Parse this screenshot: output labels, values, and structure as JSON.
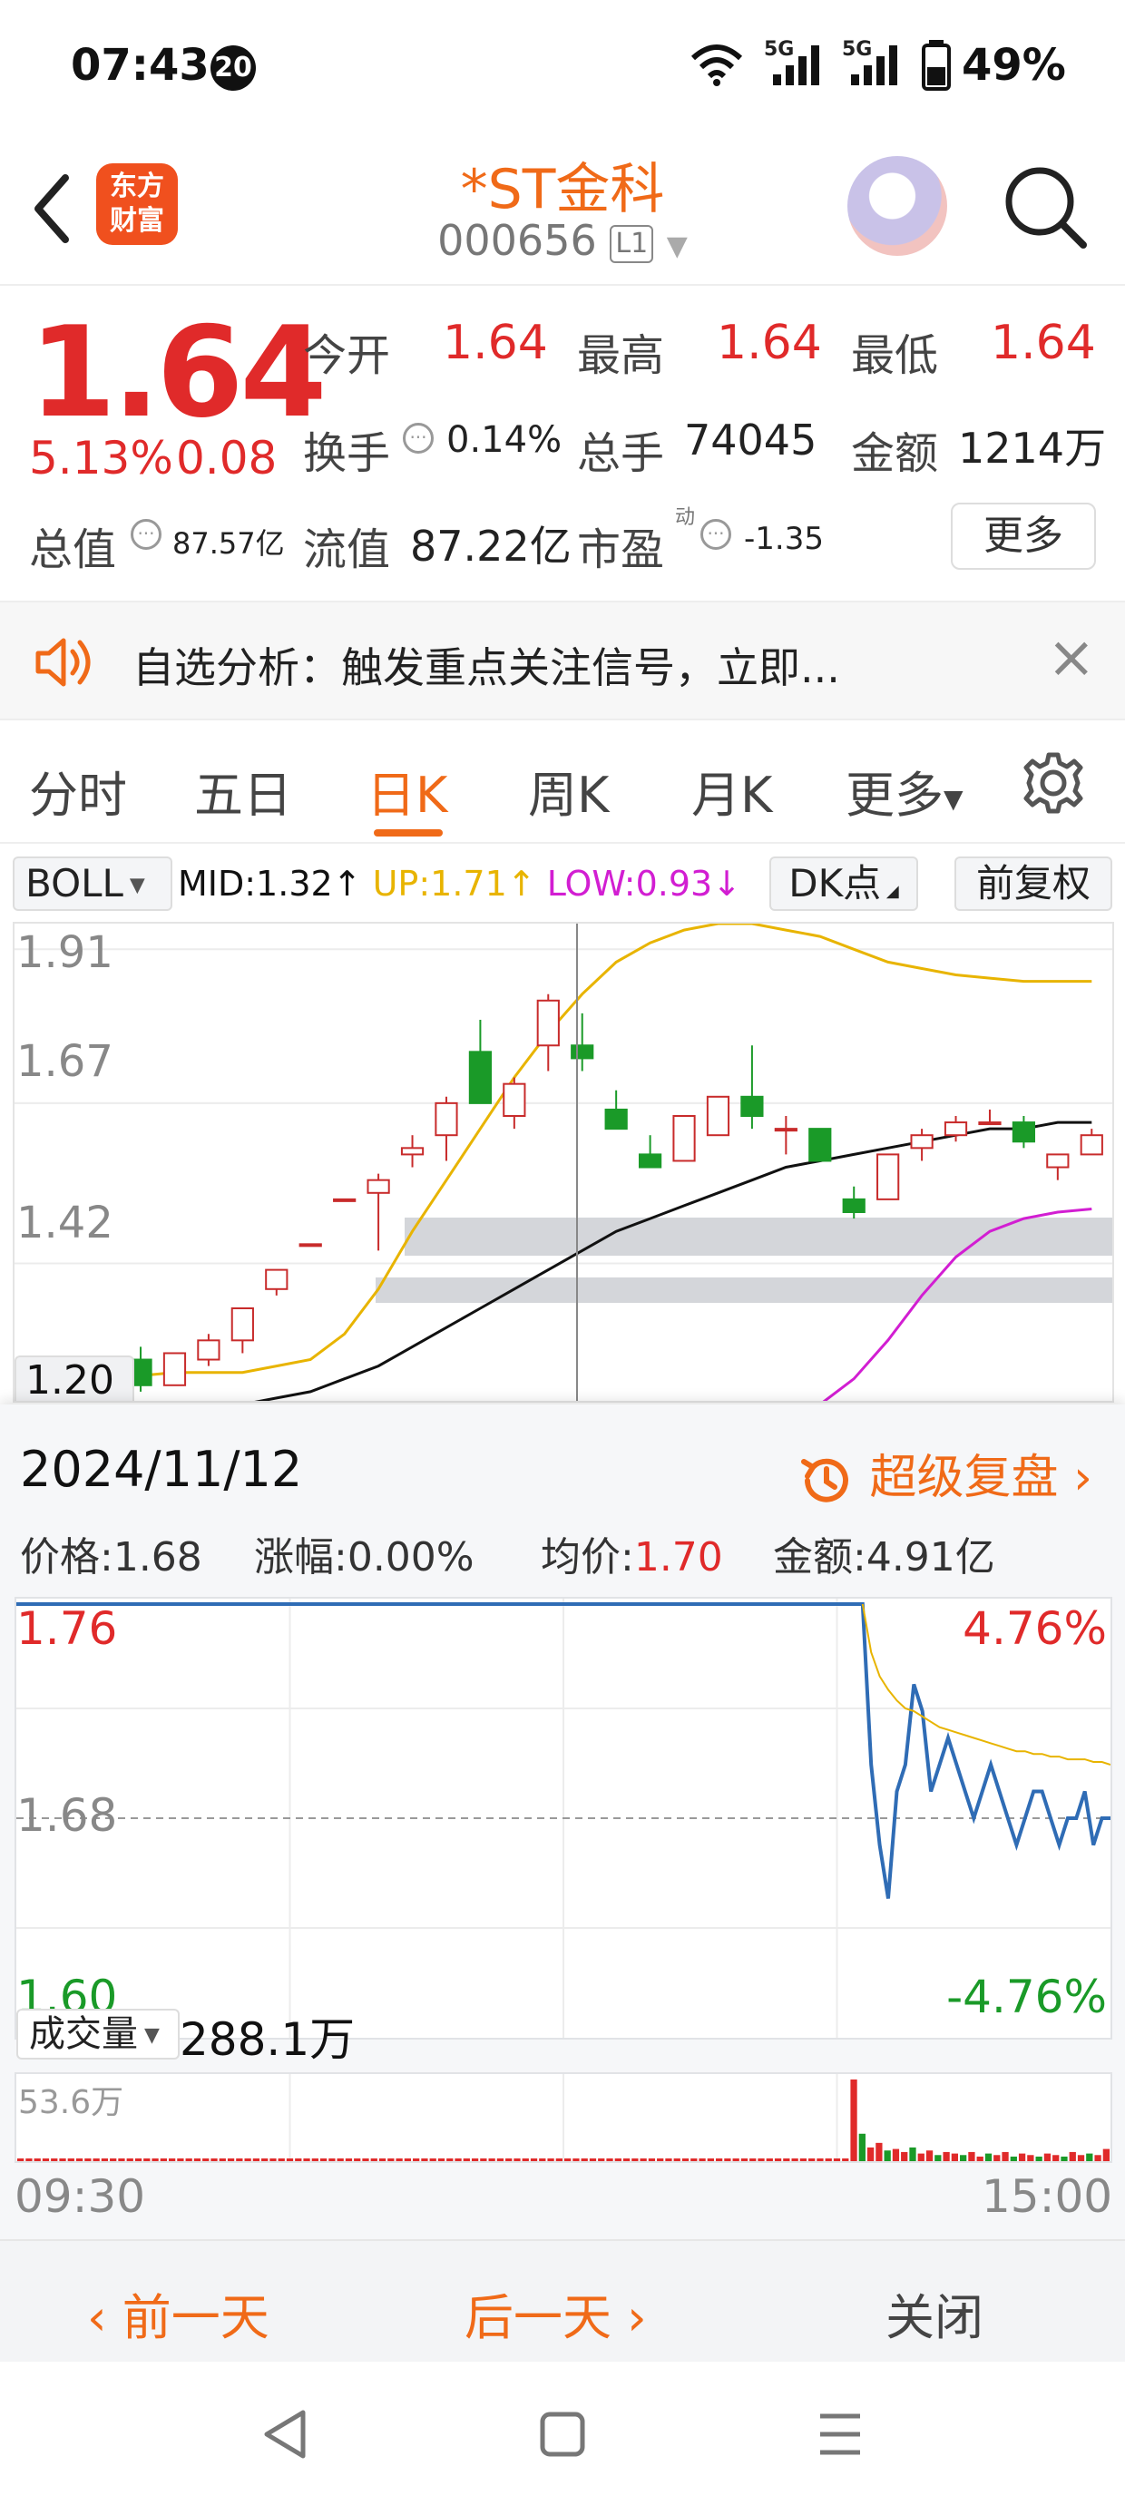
{
  "status_bar": {
    "time": "07:43",
    "notification_count": "20",
    "network_1": "5G",
    "network_2": "5G",
    "battery": "49%"
  },
  "header": {
    "logo_line1": "东方",
    "logo_line2": "财富",
    "stock_name": "*ST金科",
    "stock_code": "000656",
    "level_badge": "L1"
  },
  "quote": {
    "price": "1.64",
    "change_pct": "5.13%",
    "change_amt": "0.08",
    "open_label": "今开",
    "open_value": "1.64",
    "high_label": "最高",
    "high_value": "1.64",
    "low_label": "最低",
    "low_value": "1.64",
    "turnover_label": "换手",
    "turnover_value": "0.14%",
    "volume_label": "总手",
    "volume_value": "74045",
    "amount_label": "金额",
    "amount_value": "1214万",
    "total_cap_label": "总值",
    "total_cap_value": "87.57亿",
    "float_cap_label": "流值",
    "float_cap_value": "87.22亿",
    "pe_label": "市盈",
    "pe_superscript": "动",
    "pe_value": "-1.35",
    "more_button": "更多"
  },
  "notice": {
    "text": "自选分析：触发重点关注信号，立即...",
    "close": "×"
  },
  "tabs": [
    "分时",
    "五日",
    "日K",
    "周K",
    "月K",
    "更多"
  ],
  "active_tab": "日K",
  "indicator": {
    "name": "BOLL",
    "mid": "MID:1.32↑",
    "up": "UP:1.71↑",
    "low": "LOW:0.93↓",
    "dk_button": "DK点",
    "adjust_button": "前复权",
    "colors": {
      "mid": "#111111",
      "up": "#e8b400",
      "low": "#d21ed2"
    }
  },
  "kline": {
    "y_labels": [
      "1.91",
      "1.67",
      "1.42",
      "1.20"
    ]
  },
  "popup": {
    "date": "2024/11/12",
    "review_button": "超级复盘",
    "price_label": "价格:",
    "price_value": "1.68",
    "change_label": "涨幅:",
    "change_value": "0.00%",
    "avg_label": "均价:",
    "avg_value": "1.70",
    "amount_label": "金额:",
    "amount_value": "4.91亿",
    "y_top": "1.76",
    "y_mid": "1.68",
    "y_bottom": "1.60",
    "pct_top": "4.76%",
    "pct_bottom": "-4.76%",
    "volume_selector": "成交量",
    "volume_total": "288.1万",
    "volume_max": "53.6万",
    "time_start": "09:30",
    "time_end": "15:00",
    "prev_day": "前一天",
    "next_day": "后一天",
    "close": "关闭"
  },
  "chart_data": [
    {
      "type": "candlestick",
      "title": "",
      "y_tick_labels": [
        "1.91",
        "1.67",
        "1.42",
        "1.20"
      ],
      "ylim": [
        1.2,
        1.95
      ],
      "candles": [
        {
          "o": 1.19,
          "h": 1.2,
          "l": 1.18,
          "c": 1.19
        },
        {
          "o": 1.2,
          "h": 1.21,
          "l": 1.2,
          "c": 1.21
        },
        {
          "o": 1.2,
          "h": 1.25,
          "l": 1.2,
          "c": 1.25
        },
        {
          "o": 1.27,
          "h": 1.29,
          "l": 1.22,
          "c": 1.23
        },
        {
          "o": 1.23,
          "h": 1.28,
          "l": 1.23,
          "c": 1.28
        },
        {
          "o": 1.27,
          "h": 1.31,
          "l": 1.26,
          "c": 1.3
        },
        {
          "o": 1.3,
          "h": 1.35,
          "l": 1.28,
          "c": 1.35
        },
        {
          "o": 1.38,
          "h": 1.41,
          "l": 1.37,
          "c": 1.41
        },
        {
          "o": 1.45,
          "h": 1.45,
          "l": 1.45,
          "c": 1.45
        },
        {
          "o": 1.52,
          "h": 1.52,
          "l": 1.52,
          "c": 1.52
        },
        {
          "o": 1.53,
          "h": 1.56,
          "l": 1.44,
          "c": 1.55
        },
        {
          "o": 1.59,
          "h": 1.62,
          "l": 1.57,
          "c": 1.6
        },
        {
          "o": 1.62,
          "h": 1.68,
          "l": 1.58,
          "c": 1.67
        },
        {
          "o": 1.75,
          "h": 1.8,
          "l": 1.67,
          "c": 1.67
        },
        {
          "o": 1.65,
          "h": 1.71,
          "l": 1.63,
          "c": 1.7
        },
        {
          "o": 1.76,
          "h": 1.84,
          "l": 1.72,
          "c": 1.83
        },
        {
          "o": 1.76,
          "h": 1.81,
          "l": 1.72,
          "c": 1.74
        },
        {
          "o": 1.66,
          "h": 1.69,
          "l": 1.63,
          "c": 1.63
        },
        {
          "o": 1.59,
          "h": 1.62,
          "l": 1.57,
          "c": 1.57
        },
        {
          "o": 1.58,
          "h": 1.65,
          "l": 1.58,
          "c": 1.65
        },
        {
          "o": 1.62,
          "h": 1.68,
          "l": 1.62,
          "c": 1.68
        },
        {
          "o": 1.68,
          "h": 1.76,
          "l": 1.63,
          "c": 1.65
        },
        {
          "o": 1.63,
          "h": 1.65,
          "l": 1.59,
          "c": 1.63
        },
        {
          "o": 1.63,
          "h": 1.63,
          "l": 1.58,
          "c": 1.58
        },
        {
          "o": 1.52,
          "h": 1.54,
          "l": 1.49,
          "c": 1.5
        },
        {
          "o": 1.52,
          "h": 1.59,
          "l": 1.52,
          "c": 1.59
        },
        {
          "o": 1.6,
          "h": 1.63,
          "l": 1.58,
          "c": 1.62
        },
        {
          "o": 1.62,
          "h": 1.65,
          "l": 1.61,
          "c": 1.64
        },
        {
          "o": 1.64,
          "h": 1.66,
          "l": 1.64,
          "c": 1.64
        },
        {
          "o": 1.64,
          "h": 1.65,
          "l": 1.6,
          "c": 1.61
        },
        {
          "o": 1.57,
          "h": 1.59,
          "l": 1.55,
          "c": 1.59
        },
        {
          "o": 1.59,
          "h": 1.63,
          "l": 1.59,
          "c": 1.62
        }
      ],
      "boll_mid": [
        1.19,
        1.19,
        1.19,
        1.19,
        1.2,
        1.2,
        1.2,
        1.21,
        1.22,
        1.24,
        1.26,
        1.29,
        1.32,
        1.35,
        1.38,
        1.41,
        1.44,
        1.47,
        1.49,
        1.51,
        1.53,
        1.55,
        1.57,
        1.58,
        1.59,
        1.6,
        1.61,
        1.62,
        1.63,
        1.63,
        1.64,
        1.64
      ],
      "boll_up": [
        1.24,
        1.24,
        1.245,
        1.245,
        1.25,
        1.25,
        1.25,
        1.26,
        1.27,
        1.31,
        1.38,
        1.47,
        1.55,
        1.63,
        1.71,
        1.78,
        1.84,
        1.89,
        1.92,
        1.94,
        1.95,
        1.95,
        1.94,
        1.93,
        1.91,
        1.89,
        1.88,
        1.87,
        1.865,
        1.86,
        1.86,
        1.86
      ],
      "boll_low": [
        null,
        null,
        null,
        null,
        null,
        null,
        null,
        null,
        null,
        null,
        null,
        null,
        null,
        null,
        null,
        null,
        null,
        null,
        null,
        null,
        null,
        null,
        null,
        1.2,
        1.24,
        1.3,
        1.37,
        1.43,
        1.47,
        1.49,
        1.5,
        1.505
      ]
    },
    {
      "type": "line",
      "title": "",
      "x_tick_labels": [
        "09:30",
        "15:00"
      ],
      "y_tick_labels": [
        "1.76",
        "1.68",
        "1.60"
      ],
      "ylim": [
        1.6,
        1.76
      ],
      "series": [
        {
          "values": [
            1.76,
            1.76,
            1.76,
            1.76,
            1.76,
            1.76,
            1.76,
            1.76,
            1.76,
            1.76,
            1.76,
            1.76,
            1.76,
            1.76,
            1.76,
            1.76,
            1.76,
            1.76,
            1.76,
            1.76,
            1.76,
            1.76,
            1.76,
            1.76,
            1.76,
            1.76,
            1.76,
            1.76,
            1.76,
            1.76,
            1.76,
            1.76,
            1.76,
            1.76,
            1.76,
            1.76,
            1.76,
            1.76,
            1.76,
            1.76,
            1.76,
            1.76,
            1.76,
            1.76,
            1.76,
            1.76,
            1.76,
            1.76,
            1.76,
            1.76,
            1.76,
            1.76,
            1.76,
            1.76,
            1.76,
            1.76,
            1.76,
            1.76,
            1.76,
            1.76,
            1.76,
            1.76,
            1.76,
            1.76,
            1.76,
            1.76,
            1.76,
            1.76,
            1.76,
            1.76,
            1.76,
            1.76,
            1.76,
            1.76,
            1.76,
            1.76,
            1.76,
            1.76,
            1.76,
            1.76,
            1.76,
            1.76,
            1.76,
            1.76,
            1.76,
            1.76,
            1.76,
            1.76,
            1.76,
            1.76,
            1.76,
            1.76,
            1.76,
            1.76,
            1.76,
            1.76,
            1.76,
            1.76,
            1.76,
            1.76,
            1.7,
            1.67,
            1.65,
            1.69,
            1.7,
            1.73,
            1.72,
            1.69,
            1.7,
            1.71,
            1.7,
            1.69,
            1.68,
            1.69,
            1.7,
            1.69,
            1.68,
            1.67,
            1.68,
            1.69,
            1.69,
            1.68,
            1.67,
            1.68,
            1.68,
            1.69,
            1.67,
            1.68,
            1.68
          ]
        },
        {
          "values": [
            null,
            null,
            null,
            null,
            null,
            null,
            null,
            null,
            null,
            null,
            null,
            null,
            null,
            null,
            null,
            null,
            null,
            null,
            null,
            null,
            null,
            null,
            null,
            null,
            null,
            null,
            null,
            null,
            null,
            null,
            null,
            null,
            null,
            null,
            null,
            null,
            null,
            null,
            null,
            null,
            null,
            null,
            null,
            null,
            null,
            null,
            null,
            null,
            null,
            null,
            null,
            null,
            null,
            null,
            null,
            null,
            null,
            null,
            null,
            null,
            null,
            null,
            null,
            null,
            null,
            null,
            null,
            null,
            null,
            null,
            null,
            null,
            null,
            null,
            null,
            null,
            null,
            null,
            null,
            null,
            null,
            null,
            null,
            null,
            null,
            null,
            null,
            null,
            null,
            null,
            null,
            null,
            null,
            null,
            null,
            null,
            null,
            null,
            null,
            1.76,
            1.742,
            1.733,
            1.728,
            1.724,
            1.721,
            1.72,
            1.718,
            1.716,
            1.714,
            1.713,
            1.712,
            1.711,
            1.71,
            1.709,
            1.708,
            1.707,
            1.706,
            1.705,
            1.705,
            1.704,
            1.704,
            1.703,
            1.703,
            1.702,
            1.702,
            1.702,
            1.701,
            1.701,
            1.7
          ]
        }
      ]
    },
    {
      "type": "bar",
      "title": "",
      "y_tick_labels": [
        "53.6万"
      ],
      "ymax": 53.6,
      "values": [
        0.8,
        0.8,
        0.8,
        0.8,
        0.8,
        0.8,
        0.8,
        0.8,
        0.8,
        0.8,
        0.8,
        0.8,
        0.8,
        0.8,
        0.8,
        0.8,
        0.8,
        0.8,
        0.8,
        0.8,
        0.8,
        0.8,
        0.8,
        0.8,
        0.8,
        0.8,
        0.8,
        0.8,
        0.8,
        0.8,
        0.8,
        0.8,
        0.8,
        0.8,
        0.8,
        0.8,
        0.8,
        0.8,
        0.8,
        0.8,
        0.8,
        0.8,
        0.8,
        0.8,
        0.8,
        0.8,
        0.8,
        0.8,
        0.8,
        0.8,
        0.8,
        0.8,
        0.8,
        0.8,
        0.8,
        0.8,
        0.8,
        0.8,
        0.8,
        0.8,
        0.8,
        0.8,
        0.8,
        0.8,
        0.8,
        0.8,
        0.8,
        0.8,
        0.8,
        0.8,
        0.8,
        0.8,
        0.8,
        0.8,
        0.8,
        0.8,
        0.8,
        0.8,
        0.8,
        0.8,
        0.8,
        0.8,
        0.8,
        0.8,
        0.8,
        0.8,
        0.8,
        0.8,
        0.8,
        0.8,
        0.8,
        0.8,
        0.8,
        0.8,
        0.8,
        0.8,
        0.8,
        0.8,
        0.8,
        53.6,
        18,
        9,
        12,
        7,
        8,
        6,
        9,
        5,
        7,
        4,
        6,
        5,
        4,
        6,
        3,
        5,
        4,
        6,
        3,
        5,
        4,
        3,
        5,
        4,
        3,
        6,
        4,
        5,
        4,
        8
      ],
      "colors": {
        "up": "#e02a2a",
        "down": "#1a9a28"
      }
    }
  ]
}
